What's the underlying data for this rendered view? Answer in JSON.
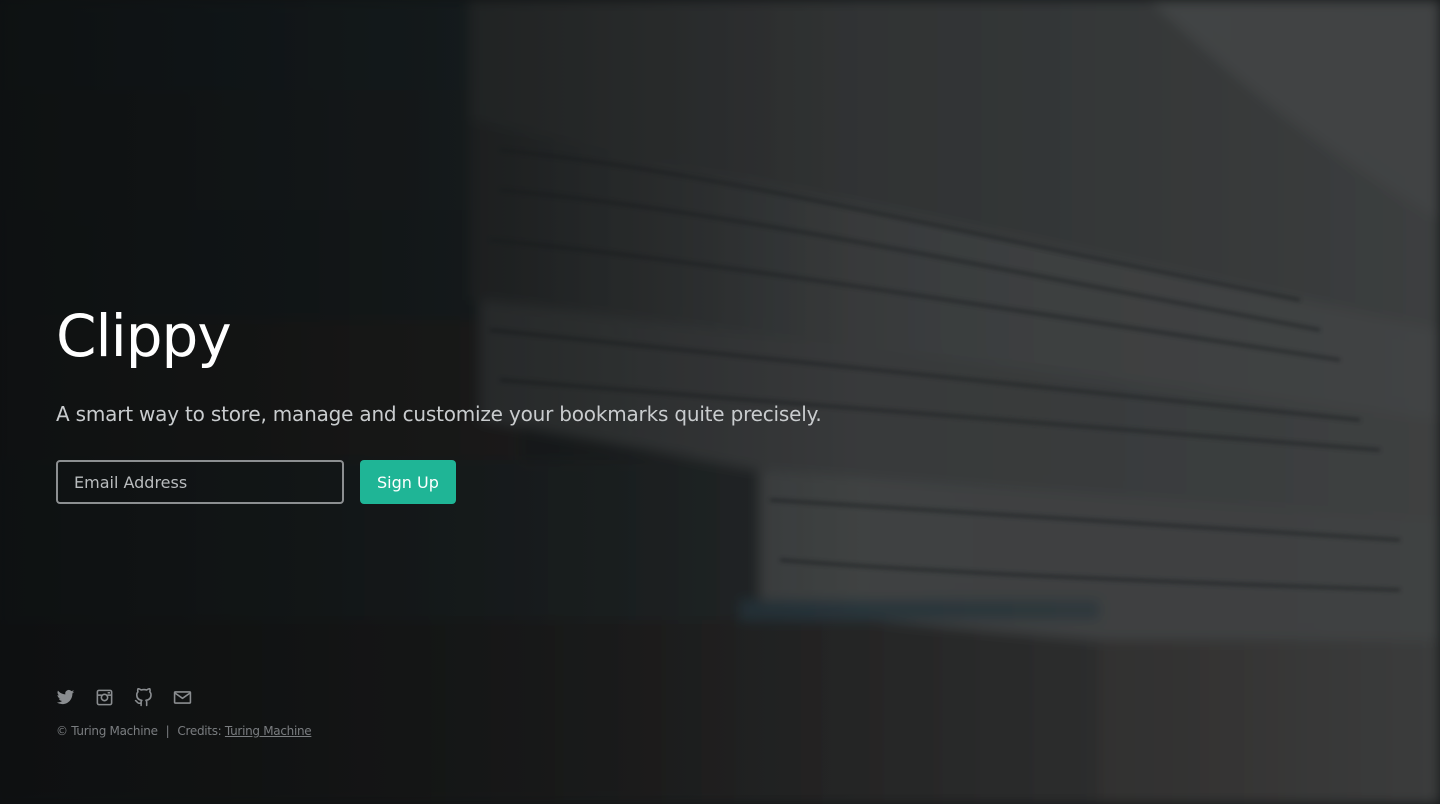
{
  "hero": {
    "title": "Clippy",
    "tagline": "A smart way to store, manage and customize your bookmarks quite precisely."
  },
  "signup": {
    "email_placeholder": "Email Address",
    "button_label": "Sign Up"
  },
  "footer": {
    "social_icons": [
      "twitter-icon",
      "instagram-icon",
      "github-icon",
      "mail-icon"
    ],
    "copyright": "© Turing Machine",
    "separator": "|",
    "credits_label": "Credits:",
    "credits_link": "Turing Machine"
  },
  "colors": {
    "accent": "#1fb596",
    "title": "#ffffff",
    "muted": "#7a7d80"
  }
}
